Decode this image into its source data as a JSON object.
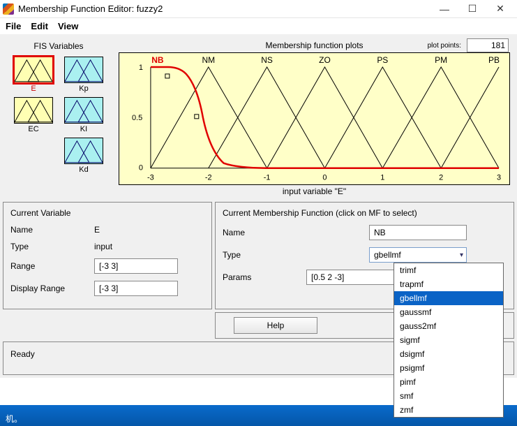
{
  "window": {
    "title": "Membership Function Editor: fuzzy2",
    "minimize": "—",
    "maximize": "☐",
    "close": "✕"
  },
  "menu": {
    "file": "File",
    "edit": "Edit",
    "view": "View"
  },
  "fis": {
    "header": "FIS Variables",
    "vars": [
      {
        "name": "E",
        "kind": "input",
        "selected": true
      },
      {
        "name": "Kp",
        "kind": "output",
        "selected": false
      },
      {
        "name": "EC",
        "kind": "input",
        "selected": false
      },
      {
        "name": "KI",
        "kind": "output",
        "selected": false
      },
      {
        "name": "Kd",
        "kind": "output",
        "selected": false
      }
    ]
  },
  "plot": {
    "title": "Membership function plots",
    "plot_points_label": "plot points:",
    "plot_points_value": "181",
    "xlabel": "input variable \"E\"",
    "mf_labels": [
      "NB",
      "NM",
      "NS",
      "ZO",
      "PS",
      "PM",
      "PB"
    ],
    "selected_mf": "NB",
    "xticks": [
      "-3",
      "-2",
      "-1",
      "0",
      "1",
      "2",
      "3"
    ],
    "yticks": [
      "0",
      "0.5",
      "1"
    ]
  },
  "current_var": {
    "header": "Current Variable",
    "name_label": "Name",
    "name_value": "E",
    "type_label": "Type",
    "type_value": "input",
    "range_label": "Range",
    "range_value": "[-3 3]",
    "disp_range_label": "Display Range",
    "disp_range_value": "[-3 3]"
  },
  "current_mf": {
    "header": "Current Membership Function (click on MF to select)",
    "name_label": "Name",
    "name_value": "NB",
    "type_label": "Type",
    "type_value": "gbellmf",
    "type_options": [
      "trimf",
      "trapmf",
      "gbellmf",
      "gaussmf",
      "gauss2mf",
      "sigmf",
      "dsigmf",
      "psigmf",
      "pimf",
      "smf",
      "zmf"
    ],
    "params_label": "Params",
    "params_value": "[0.5 2 -3]"
  },
  "help": {
    "button": "Help"
  },
  "status": {
    "text": "Ready"
  },
  "taskbar": {
    "fragment": "机。"
  },
  "chart_data": {
    "type": "line",
    "title": "Membership function plots",
    "xlabel": "input variable \"E\"",
    "ylabel": "",
    "xlim": [
      -3,
      3
    ],
    "ylim": [
      0,
      1
    ],
    "x": [
      -3,
      -2.5,
      -2,
      -1.5,
      -1,
      -0.5,
      0,
      0.5,
      1,
      1.5,
      2,
      2.5,
      3
    ],
    "series": [
      {
        "name": "NB",
        "type": "gbellmf",
        "params": [
          0.5,
          2,
          -3
        ],
        "color": "#e00000",
        "values": [
          1.0,
          0.5,
          0.06,
          0.01,
          0.0,
          0.0,
          0.0,
          0.0,
          0.0,
          0.0,
          0.0,
          0.0,
          0.0
        ]
      },
      {
        "name": "NM",
        "type": "trimf",
        "params": [
          -3,
          -2,
          -1
        ],
        "values": [
          0.0,
          0.5,
          1.0,
          0.5,
          0.0,
          0.0,
          0.0,
          0.0,
          0.0,
          0.0,
          0.0,
          0.0,
          0.0
        ]
      },
      {
        "name": "NS",
        "type": "trimf",
        "params": [
          -2,
          -1,
          0
        ],
        "values": [
          0.0,
          0.0,
          0.0,
          0.5,
          1.0,
          0.5,
          0.0,
          0.0,
          0.0,
          0.0,
          0.0,
          0.0,
          0.0
        ]
      },
      {
        "name": "ZO",
        "type": "trimf",
        "params": [
          -1,
          0,
          1
        ],
        "values": [
          0.0,
          0.0,
          0.0,
          0.0,
          0.0,
          0.5,
          1.0,
          0.5,
          0.0,
          0.0,
          0.0,
          0.0,
          0.0
        ]
      },
      {
        "name": "PS",
        "type": "trimf",
        "params": [
          0,
          1,
          2
        ],
        "values": [
          0.0,
          0.0,
          0.0,
          0.0,
          0.0,
          0.0,
          0.0,
          0.5,
          1.0,
          0.5,
          0.0,
          0.0,
          0.0
        ]
      },
      {
        "name": "PM",
        "type": "trimf",
        "params": [
          1,
          2,
          3
        ],
        "values": [
          0.0,
          0.0,
          0.0,
          0.0,
          0.0,
          0.0,
          0.0,
          0.0,
          0.0,
          0.5,
          1.0,
          0.5,
          0.0
        ]
      },
      {
        "name": "PB",
        "type": "trimf",
        "params": [
          2,
          3,
          4
        ],
        "values": [
          0.0,
          0.0,
          0.0,
          0.0,
          0.0,
          0.0,
          0.0,
          0.0,
          0.0,
          0.0,
          0.0,
          0.5,
          1.0
        ]
      }
    ]
  }
}
